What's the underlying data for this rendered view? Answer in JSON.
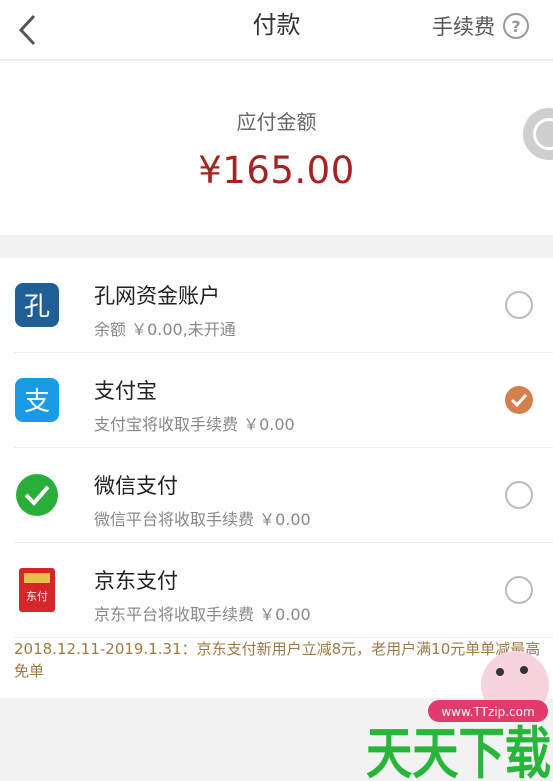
{
  "header": {
    "title": "付款",
    "fee_label": "手续费",
    "help_icon": "question-circle-icon",
    "back_icon": "chevron-left-icon"
  },
  "amount": {
    "label": "应付金额",
    "value": "¥165.00",
    "color": "#a32222"
  },
  "payment_methods": [
    {
      "name": "孔网资金账户",
      "desc": "余额 ￥0.00,未开通",
      "icon": "kongwang-icon",
      "checked": false
    },
    {
      "name": "支付宝",
      "desc": "支付宝将收取手续费 ￥0.00",
      "icon": "alipay-icon",
      "checked": true
    },
    {
      "name": "微信支付",
      "desc": "微信平台将收取手续费 ￥0.00",
      "icon": "wechat-pay-icon",
      "checked": false
    },
    {
      "name": "京东支付",
      "desc": "京东平台将收取手续费 ￥0.00",
      "icon": "jd-pay-icon",
      "checked": false
    }
  ],
  "promo": "2018.12.11-2019.1.31：京东支付新用户立减8元，老用户满10元单单减最高免单",
  "watermark": {
    "url": "www.TTzip.com",
    "text": "天天下载"
  },
  "colors": {
    "accent": "#d37f4f",
    "promo": "#9a7b45"
  }
}
